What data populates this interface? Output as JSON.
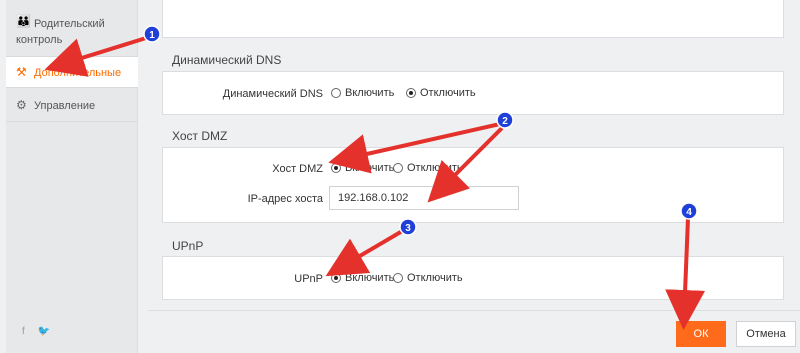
{
  "sidebar": {
    "items": [
      {
        "label": "Родительский контроль",
        "icon": "family-icon"
      },
      {
        "label": "Дополнительные",
        "icon": "tools-icon"
      },
      {
        "label": "Управление",
        "icon": "gear-icon"
      }
    ],
    "social": "f  🐦"
  },
  "ddns": {
    "title": "Динамический DNS",
    "label": "Динамический DNS",
    "on_label": "Включить",
    "off_label": "Отключить",
    "selected": "off"
  },
  "dmz": {
    "title": "Хост DMZ",
    "label": "Хост DMZ",
    "on_label": "Включить",
    "off_label": "Отключить",
    "selected": "on",
    "ip_label": "IP-адрес хоста",
    "ip_value": "192.168.0.102"
  },
  "upnp": {
    "title": "UPnP",
    "label": "UPnP",
    "on_label": "Включить",
    "off_label": "Отключить",
    "selected": "on"
  },
  "footer": {
    "ok_label": "ОК",
    "cancel_label": "Отмена"
  },
  "annotations": [
    "1",
    "2",
    "3",
    "4"
  ],
  "colors": {
    "accent": "#ff6b1a",
    "arrow": "#e4312b",
    "badge": "#1f3fd8"
  }
}
